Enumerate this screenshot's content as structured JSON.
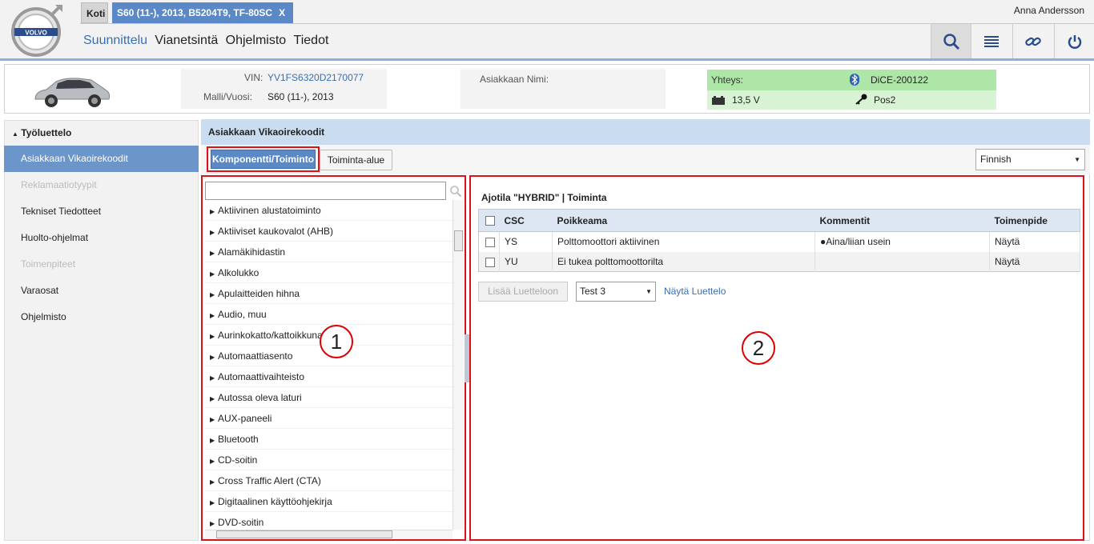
{
  "header": {
    "tab_home": "Koti",
    "tab_vehicle": "S60 (11-), 2013, B5204T9, TF-80SC",
    "tab_close": "X",
    "user": "Anna Andersson",
    "nav": [
      "Suunnittelu",
      "Vianetsintä",
      "Ohjelmisto",
      "Tiedot"
    ],
    "nav_active": "Suunnittelu",
    "logo_text": "VOLVO",
    "icons": [
      "search-icon",
      "list-icon",
      "link-icon",
      "power-icon"
    ]
  },
  "vehicle": {
    "vin_label": "VIN:",
    "vin": "YV1FS6320D2170077",
    "model_label": "Malli/Vuosi:",
    "model": "S60 (11-), 2013",
    "customer_label": "Asiakkaan Nimi:",
    "customer": "",
    "connection_label": "Yhteys:",
    "device": "DiCE-200122",
    "voltage": "13,5 V",
    "key_pos": "Pos2"
  },
  "sidebar": {
    "title": "Työluettelo",
    "items": [
      {
        "label": "Asiakkaan Vikaoirekoodit",
        "state": "active"
      },
      {
        "label": "Reklamaatiotyypit",
        "state": "disabled"
      },
      {
        "label": "Tekniset Tiedotteet",
        "state": "normal"
      },
      {
        "label": "Huolto-ohjelmat",
        "state": "normal"
      },
      {
        "label": "Toimenpiteet",
        "state": "disabled"
      },
      {
        "label": "Varaosat",
        "state": "normal"
      },
      {
        "label": "Ohjelmisto",
        "state": "normal"
      }
    ]
  },
  "main": {
    "title": "Asiakkaan Vikaoirekoodit",
    "tab_component": "Komponentti/Toiminto",
    "tab_area": "Toiminta-alue",
    "language": "Finnish",
    "search_value": "",
    "components": [
      "Aktiivinen alustatoiminto",
      "Aktiiviset kaukovalot (AHB)",
      "Alamäkihidastin",
      "Alkolukko",
      "Apulaitteiden hihna",
      "Audio, muu",
      "Aurinkokatto/kattoikkuna",
      "Automaattiasento",
      "Automaattivaihteisto",
      "Autossa oleva laturi",
      "AUX-paneeli",
      "Bluetooth",
      "CD-soitin",
      "Cross Traffic Alert (CTA)",
      "Digitaalinen käyttöohjekirja",
      "DVD-soitin"
    ],
    "mode_title": "Ajotila \"HYBRID\" | Toiminta",
    "table": {
      "headers": [
        "CSC",
        "Poikkeama",
        "Kommentit",
        "Toimenpide"
      ],
      "rows": [
        {
          "csc": "YS",
          "deviation": "Polttomoottori aktiivinen",
          "comment": "Aina/liian usein",
          "action": "Näytä"
        },
        {
          "csc": "YU",
          "deviation": "Ei tukea polttomoottorilta",
          "comment": "",
          "action": "Näytä"
        }
      ]
    },
    "add_button": "Lisää Luetteloon",
    "list_select": "Test 3",
    "show_list": "Näytä Luettelo",
    "callout_1": "1",
    "callout_2": "2"
  },
  "colors": {
    "accent": "#5b89c7",
    "highlight": "#e0101b",
    "connection": "#aee6a8"
  }
}
